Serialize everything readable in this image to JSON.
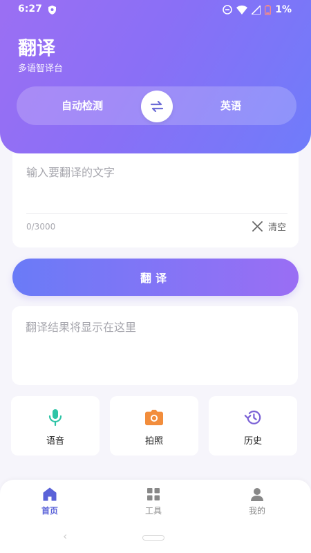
{
  "status": {
    "time": "6:27",
    "battery": "1%"
  },
  "header": {
    "title": "翻译",
    "subtitle": "多语智译台"
  },
  "languages": {
    "source": "自动检测",
    "target": "英语"
  },
  "input": {
    "placeholder": "输入要翻译的文字",
    "char_count": "0/3000",
    "clear_label": "清空"
  },
  "translate_button": {
    "label": "翻译"
  },
  "result": {
    "placeholder": "翻译结果将显示在这里"
  },
  "tools": [
    {
      "label": "语音",
      "icon": "microphone-icon",
      "color": "#2ec4a6"
    },
    {
      "label": "拍照",
      "icon": "camera-icon",
      "color": "#f28d3c"
    },
    {
      "label": "历史",
      "icon": "history-icon",
      "color": "#7b62d6"
    }
  ],
  "nav": {
    "items": [
      {
        "label": "首页",
        "icon": "home-icon",
        "active": true
      },
      {
        "label": "工具",
        "icon": "grid-icon",
        "active": false
      },
      {
        "label": "我的",
        "icon": "user-icon",
        "active": false
      }
    ]
  },
  "colors": {
    "accent": "#5a62d8",
    "gradient_start": "#9b6ff3",
    "gradient_end": "#6f7cfa"
  }
}
